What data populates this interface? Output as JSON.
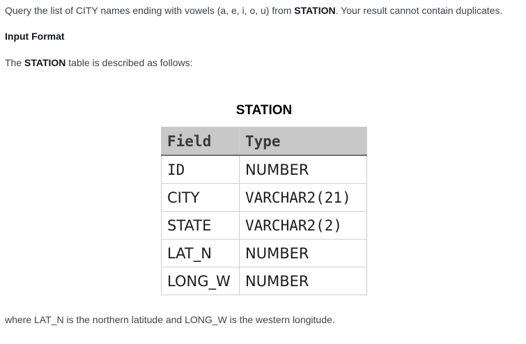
{
  "problem": {
    "prefix": "Query the list of CITY names ending with vowels (a, e, i, o, u) from ",
    "table_name": "STATION",
    "suffix": ". Your result cannot contain duplicates."
  },
  "input_format": {
    "heading": "Input Format"
  },
  "description": {
    "prefix": "The ",
    "table_name": "STATION",
    "suffix": " table is described as follows:"
  },
  "table": {
    "caption": "STATION",
    "headers": [
      "Field",
      "Type"
    ],
    "rows": [
      {
        "field": "ID",
        "type": "NUMBER"
      },
      {
        "field": "CITY",
        "type": "VARCHAR2(21)"
      },
      {
        "field": "STATE",
        "type": "VARCHAR2(2)"
      },
      {
        "field": "LAT_N",
        "type": "NUMBER"
      },
      {
        "field": "LONG_W",
        "type": "NUMBER"
      }
    ]
  },
  "footer": {
    "text": "where LAT_N is the northern latitude and LONG_W is the western longitude."
  }
}
